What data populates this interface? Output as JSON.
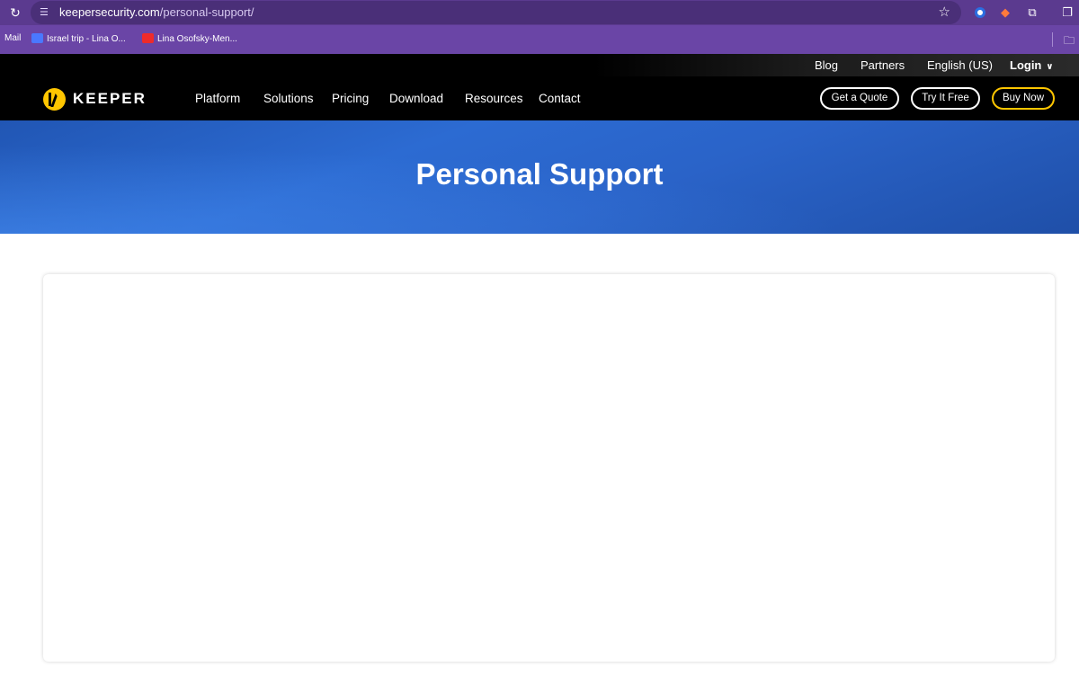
{
  "browser": {
    "url_domain": "keepersecurity.com",
    "url_path": "/personal-support/",
    "bookmarks": [
      {
        "label": "Mail"
      },
      {
        "label": "Israel trip - Lina O..."
      },
      {
        "label": "Lina Osofsky-Men..."
      }
    ],
    "icons": [
      "reload-icon",
      "site-info-icon",
      "star-icon",
      "extension-icons",
      "folder-icon"
    ]
  },
  "header": {
    "top_links": [
      "Blog",
      "Partners",
      "English (US)",
      "Login"
    ],
    "logo_text": "KEEPER",
    "nav": [
      "Platform",
      "Solutions",
      "Pricing",
      "Download",
      "Resources",
      "Contact"
    ],
    "cta": {
      "quote": "Get a Quote",
      "try": "Try It Free",
      "buy": "Buy Now"
    },
    "colors": {
      "accent": "#ffc600",
      "background": "#000000"
    }
  },
  "hero": {
    "title": "Personal Support",
    "color": "#2c6bd2"
  }
}
